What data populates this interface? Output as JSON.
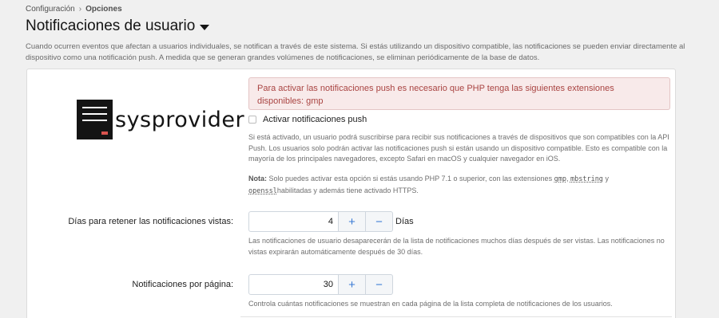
{
  "breadcrumb": {
    "root": "Configuración",
    "current": "Opciones"
  },
  "page": {
    "title": "Notificaciones de usuario",
    "description": "Cuando ocurren eventos que afectan a usuarios individuales, se notifican a través de este sistema. Si estás utilizando un dispositivo compatible, las notificaciones se pueden enviar directamente al dispositivo como una notificación push. A medida que se generan grandes volúmenes de notificaciones, se eliminan periódicamente de la base de datos."
  },
  "logo": {
    "text": "sysprovider"
  },
  "alert": {
    "text": "Para activar las notificaciones push es necesario que PHP tenga las siguientes extensiones disponibles: gmp"
  },
  "push": {
    "label": "Activar notificaciones push",
    "checked": false,
    "help": "Si está activado, un usuario podrá suscribirse para recibir sus notificaciones a través de dispositivos que son compatibles con la API Push. Los usuarios solo podrán activar las notificaciones push si están usando un dispositivo compatible. Esto es compatible con la mayoría de los principales navegadores, excepto Safari en macOS y cualquier navegador en iOS.",
    "note_label": "Nota:",
    "note_text": "Solo puedes activar esta opción si estás usando PHP 7.1 o superior, con las extensiones",
    "ext1": "gmp",
    "ext_sep": ",",
    "ext2": "mbstring",
    "ext_and": "y",
    "ext3": "openssl",
    "note_end": "habilitadas y además tiene activado HTTPS."
  },
  "retain": {
    "label": "Días para retener las notificaciones vistas:",
    "value": "4",
    "plus": "+",
    "minus": "−",
    "unit": "Días",
    "help": "Las notificaciones de usuario desaparecerán de la lista de notificaciones muchos días después de ser vistas. Las notificaciones no vistas expirarán automáticamente después de 30 días."
  },
  "per_page": {
    "label": "Notificaciones por página:",
    "value": "30",
    "plus": "+",
    "minus": "−",
    "help": "Controla cuántas notificaciones se muestran en cada página de la lista completa de notificaciones de los usuarios."
  },
  "colors": {
    "alert_text": "#a94442",
    "alert_bg": "#f8eaea",
    "accent": "#3a7bd5"
  }
}
